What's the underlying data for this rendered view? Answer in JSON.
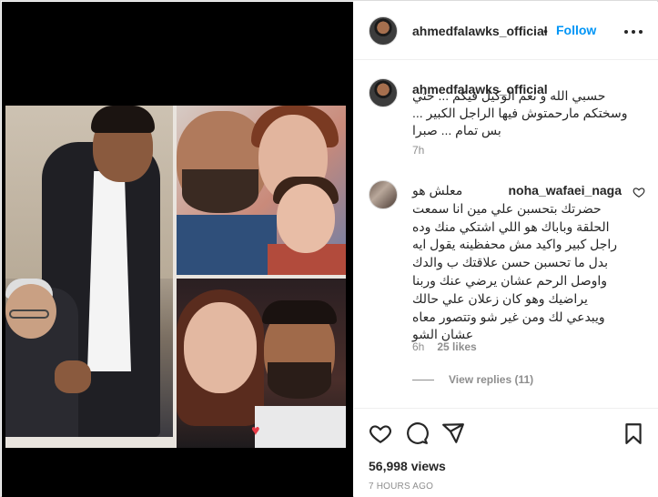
{
  "post": {
    "author": "ahmedfalawks_official",
    "follow_label": "Follow",
    "separator": "•"
  },
  "caption": {
    "username": "ahmedfalawks_official",
    "text": "حسبي الله و نعم الوكيل فيكم ... حتي وسختكم مارحمتوش فيها الراجل الكبير ... بس تمام ... صبرا",
    "time": "7h"
  },
  "comment": {
    "username": "noha_wafaei_naga",
    "text": "معلش هو حضرتك بتحسبن علي مين انا سمعت الحلقة وباباك هو اللي اشتكي منك وده راجل كبير واكيد مش محفظينه يقول ايه بدل ما تحسبن حسن علاقتك ب والدك واوصل الرحم عشان يرضي عنك وربنا يراضيك وهو كان زعلان علي حالك ويبدعي لك ومن غير شو وتتصور معاه عشان الشو",
    "time": "6h",
    "likes": "25 likes",
    "view_replies": "View replies (11)"
  },
  "stats": {
    "views": "56,998 views",
    "ago": "7 HOURS AGO"
  },
  "icons": {
    "more": "more-options-icon",
    "like": "heart-icon",
    "comment": "comment-icon",
    "share": "share-icon",
    "save": "bookmark-icon",
    "comment_like": "small-heart-icon"
  },
  "colors": {
    "accent": "#0095f6",
    "text": "#262626",
    "secondary": "#8e8e8e",
    "border": "#dbdbdb"
  }
}
